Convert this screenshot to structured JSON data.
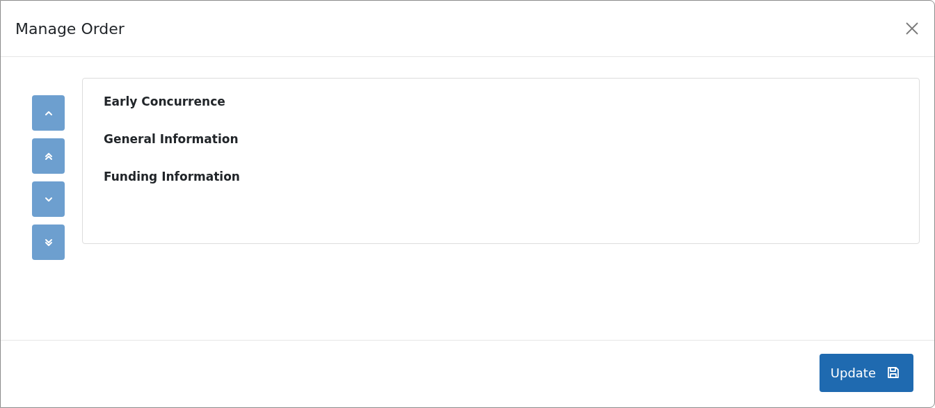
{
  "dialog": {
    "title": "Manage Order"
  },
  "move_buttons": [
    {
      "kind": "up",
      "disabled": true
    },
    {
      "kind": "top",
      "disabled": true
    },
    {
      "kind": "down",
      "disabled": true
    },
    {
      "kind": "bottom",
      "disabled": true
    }
  ],
  "items": [
    "Early Concurrence",
    "General Information",
    "Funding Information"
  ],
  "footer": {
    "button": "Update"
  }
}
